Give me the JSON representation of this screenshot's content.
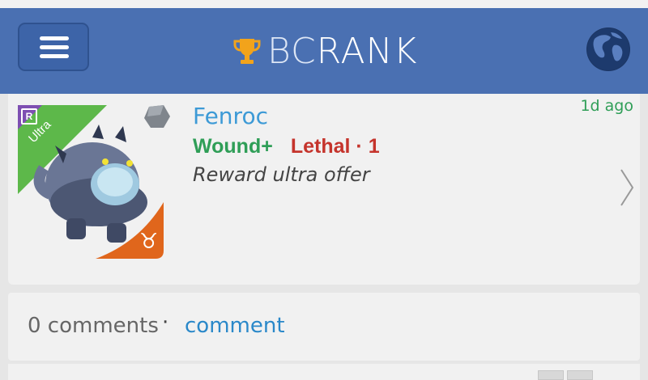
{
  "header": {
    "brand_prefix": "BC",
    "brand_suffix": "RANK",
    "menu_icon": "hamburger-menu-icon",
    "trophy_icon": "trophy-icon",
    "globe_icon": "globe-icon"
  },
  "post": {
    "monster_name": "Fenroc",
    "rarity_badge": "Ultra",
    "rarity_letter": "R",
    "tag_wound": "Wound+",
    "tag_lethal": "Lethal",
    "tag_separator": "·",
    "tag_lethal_count": "1",
    "description": "Reward ultra offer",
    "time_ago": "1d ago"
  },
  "comments": {
    "count_label": "0 comments",
    "separator": "·",
    "link_label": "comment"
  },
  "colors": {
    "navbar": "#4a70b2",
    "name_link": "#3d9ad6",
    "wound": "#2f9e57",
    "lethal": "#c5342c",
    "rarity_ultra": "#5db84a"
  }
}
